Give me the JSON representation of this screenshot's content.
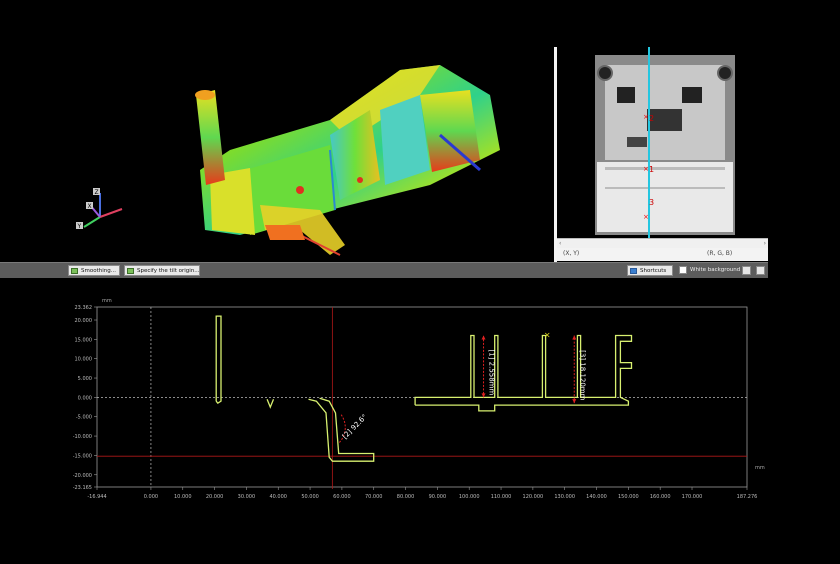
{
  "axis_triad": {
    "z": "Z",
    "x": "X",
    "y": "Y"
  },
  "toolbar": {
    "smoothing_label": "Smoothing...",
    "tilt_label": "Specify the tilt origin...",
    "shortcuts_label": "Shortcuts",
    "white_background_label": "White background"
  },
  "right_status": {
    "coords": "(X, Y)",
    "rgb": "(R, G, B)"
  },
  "scan_markers": [
    "1",
    "2",
    "3"
  ],
  "chart_data": {
    "type": "line",
    "xlabel": "mm",
    "ylabel": "mm",
    "xlim": [
      -16.944,
      187.276
    ],
    "ylim": [
      -23.165,
      23.362
    ],
    "x_ticks": [
      "-16.944",
      "0.000",
      "10.000",
      "20.000",
      "30.000",
      "40.000",
      "50.000",
      "60.000",
      "70.000",
      "80.000",
      "90.000",
      "100.000",
      "110.000",
      "120.000",
      "130.000",
      "140.000",
      "150.000",
      "160.000",
      "170.000",
      "187.276"
    ],
    "y_ticks": [
      "23.362",
      "20.000",
      "15.000",
      "10.000",
      "5.000",
      "0.000",
      "-5.000",
      "-10.000",
      "-15.000",
      "-20.000",
      "-23.165"
    ],
    "annotations": [
      {
        "label": "[1] 2.558mm",
        "x": 104.5,
        "y_from": 0.0,
        "y_to": 16.0
      },
      {
        "label": "[2] 92.6°",
        "x": 62.0,
        "y": -9.0
      },
      {
        "label": "[3] 18.120mm",
        "x": 133.0,
        "y_from": -1.5,
        "y_to": 16.0
      }
    ],
    "reference_lines": {
      "horizontal_y": -15.2,
      "vertical_x": 57.0
    }
  }
}
